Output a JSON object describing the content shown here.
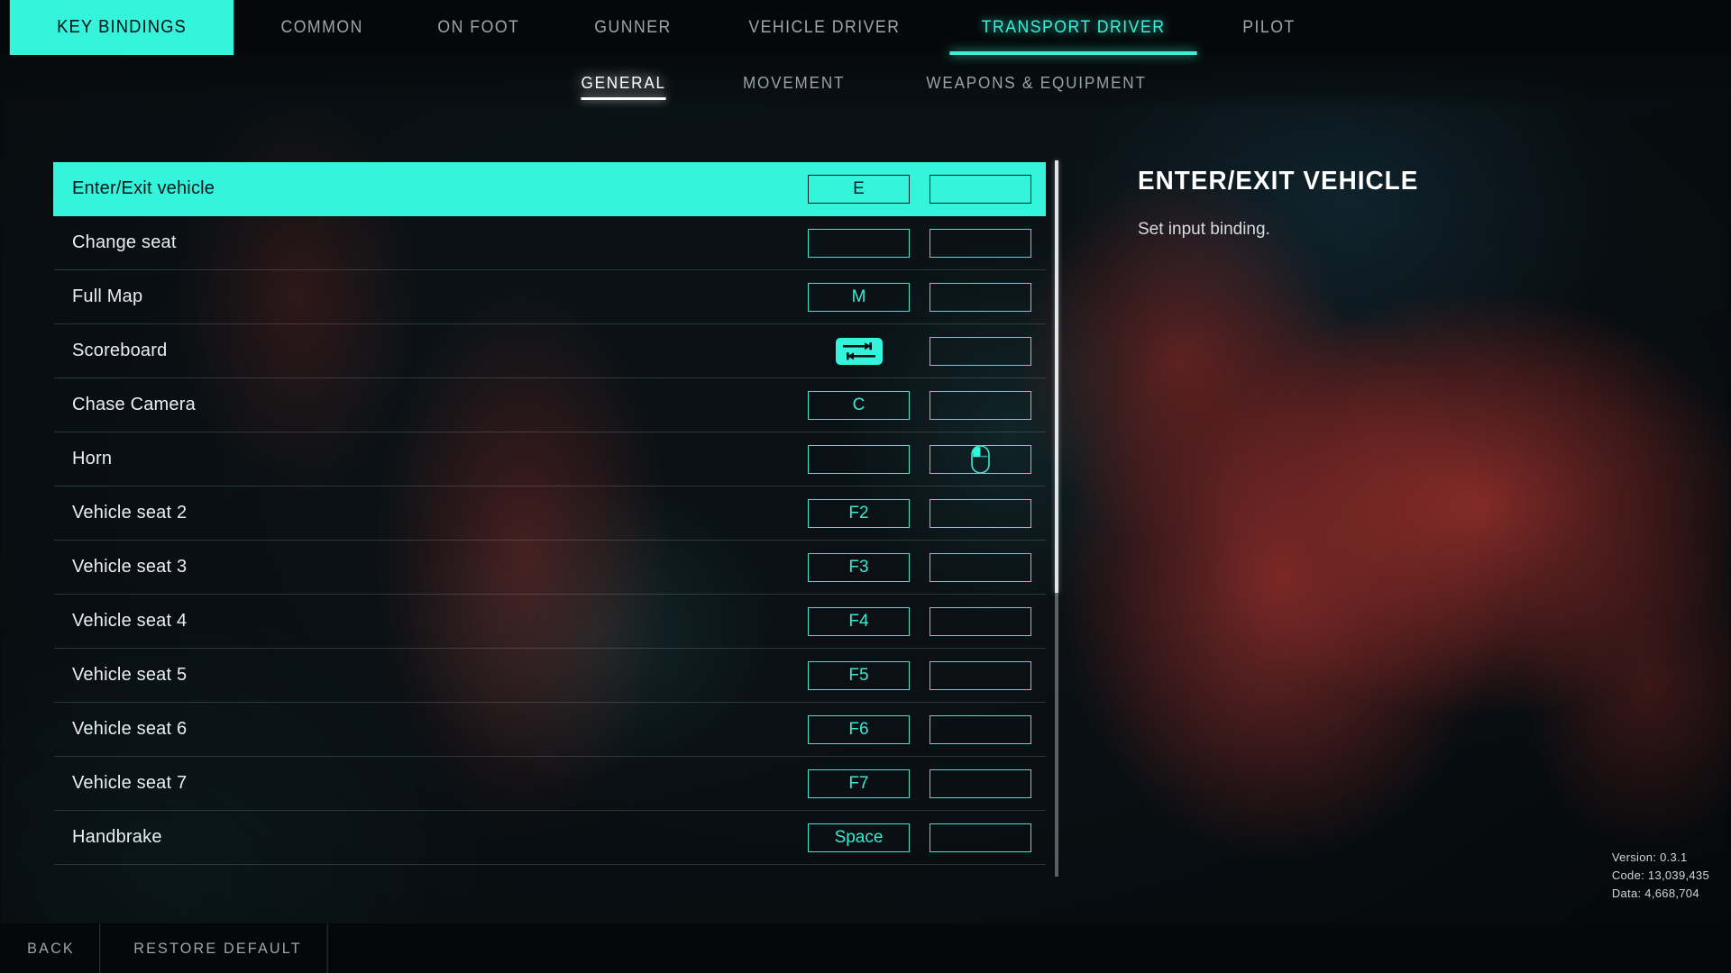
{
  "brand": {
    "label": "KEY BINDINGS"
  },
  "topnav": {
    "tabs": [
      {
        "label": "COMMON",
        "active": false
      },
      {
        "label": "ON FOOT",
        "active": false
      },
      {
        "label": "GUNNER",
        "active": false
      },
      {
        "label": "VEHICLE DRIVER",
        "active": false
      },
      {
        "label": "TRANSPORT DRIVER",
        "active": true
      },
      {
        "label": "PILOT",
        "active": false
      }
    ]
  },
  "subnav": {
    "tabs": [
      {
        "label": "GENERAL",
        "active": true
      },
      {
        "label": "MOVEMENT",
        "active": false
      },
      {
        "label": "WEAPONS & EQUIPMENT",
        "active": false
      }
    ]
  },
  "bindings": {
    "rows": [
      {
        "label": "Enter/Exit vehicle",
        "primary": "E",
        "primary_icon": "",
        "secondary": "",
        "secondary_icon": "",
        "selected": true
      },
      {
        "label": "Change seat",
        "primary": "",
        "primary_icon": "",
        "secondary": "",
        "secondary_icon": "",
        "selected": false
      },
      {
        "label": "Full Map",
        "primary": "M",
        "primary_icon": "",
        "secondary": "",
        "secondary_icon": "",
        "selected": false
      },
      {
        "label": "Scoreboard",
        "primary": "",
        "primary_icon": "tab-key-icon",
        "secondary": "",
        "secondary_icon": "",
        "selected": false
      },
      {
        "label": "Chase Camera",
        "primary": "C",
        "primary_icon": "",
        "secondary": "",
        "secondary_icon": "",
        "selected": false
      },
      {
        "label": "Horn",
        "primary": "",
        "primary_icon": "",
        "secondary": "",
        "secondary_icon": "mouse-left-button-icon",
        "selected": false
      },
      {
        "label": "Vehicle seat 2",
        "primary": "F2",
        "primary_icon": "",
        "secondary": "",
        "secondary_icon": "",
        "selected": false
      },
      {
        "label": "Vehicle seat 3",
        "primary": "F3",
        "primary_icon": "",
        "secondary": "",
        "secondary_icon": "",
        "selected": false
      },
      {
        "label": "Vehicle seat 4",
        "primary": "F4",
        "primary_icon": "",
        "secondary": "",
        "secondary_icon": "",
        "selected": false
      },
      {
        "label": "Vehicle seat 5",
        "primary": "F5",
        "primary_icon": "",
        "secondary": "",
        "secondary_icon": "",
        "selected": false
      },
      {
        "label": "Vehicle seat 6",
        "primary": "F6",
        "primary_icon": "",
        "secondary": "",
        "secondary_icon": "",
        "selected": false
      },
      {
        "label": "Vehicle seat 7",
        "primary": "F7",
        "primary_icon": "",
        "secondary": "",
        "secondary_icon": "",
        "selected": false
      },
      {
        "label": "Handbrake",
        "primary": "Space",
        "primary_icon": "",
        "secondary": "",
        "secondary_icon": "",
        "selected": false
      }
    ]
  },
  "detail": {
    "title": "ENTER/EXIT VEHICLE",
    "description": "Set input binding."
  },
  "version": {
    "line1": "Version: 0.3.1",
    "line2": "Code: 13,039,435",
    "line3": "Data: 4,668,704"
  },
  "bottombar": {
    "back_label": "BACK",
    "restore_label": "RESTORE DEFAULT"
  },
  "colors": {
    "accent": "#34F5DC",
    "accent_border": "#3BE9D2",
    "panel_bg": "#05080a",
    "text_primary": "#e9eff0",
    "text_muted": "#9aa6a8",
    "selected_text": "#05191c"
  }
}
